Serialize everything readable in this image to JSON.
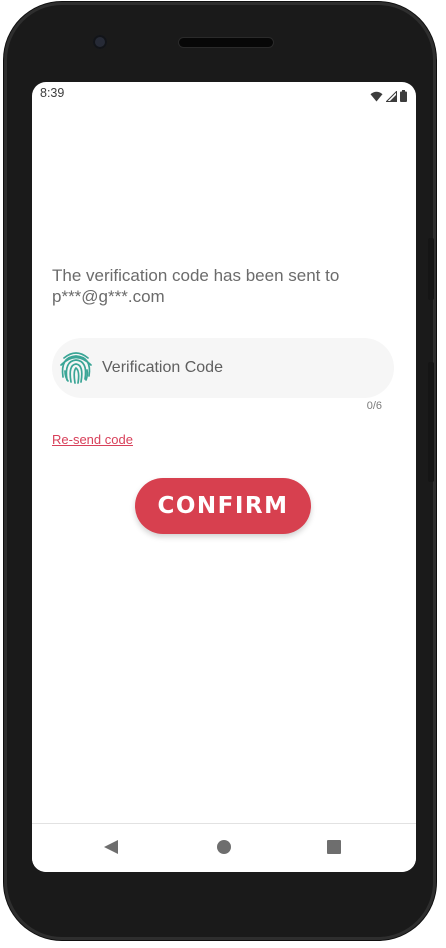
{
  "status_bar": {
    "time": "8:39",
    "icons": [
      "wifi-icon",
      "cellular-signal-icon",
      "battery-icon"
    ]
  },
  "verification": {
    "message_line1": "The verification code has been sent to",
    "message_line2": "p***@g***.com",
    "code_placeholder": "Verification Code",
    "code_value": "",
    "counter": "0/6",
    "resend_label": "Re-send code",
    "field_icon": "fingerprint-icon"
  },
  "actions": {
    "confirm_label": "CONFIRM"
  },
  "nav_bar": {
    "icons": [
      "back-icon",
      "home-icon",
      "recents-icon"
    ]
  },
  "colors": {
    "accent": "#d7404f",
    "link": "#d8405a",
    "fingerprint": "#3aa596",
    "field_background": "#f6f6f6"
  }
}
